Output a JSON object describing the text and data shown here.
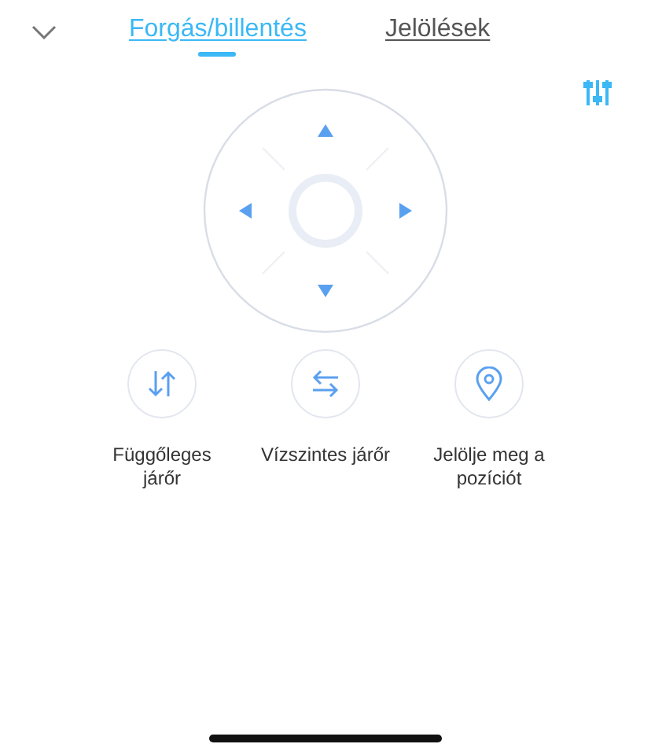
{
  "tabs": [
    {
      "label": "Forgás/billentés",
      "selected": true
    },
    {
      "label": "Jelölések",
      "selected": false
    }
  ],
  "actions": [
    {
      "kind": "vertical",
      "label": "Függőleges járőr"
    },
    {
      "kind": "horizontal",
      "label": "Vízszintes járőr"
    },
    {
      "kind": "location",
      "label": "Jelölje meg a pozíciót"
    }
  ]
}
